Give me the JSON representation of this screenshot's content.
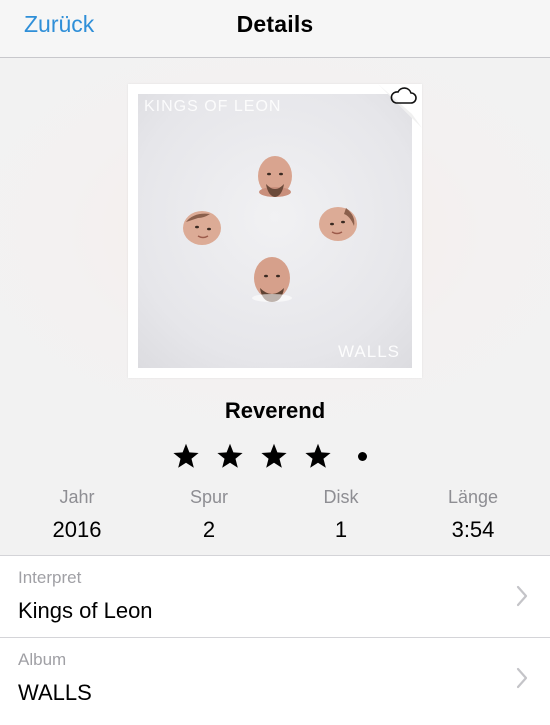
{
  "navbar": {
    "back_label": "Zurück",
    "title": "Details"
  },
  "artwork": {
    "band_text": "KINGS OF LEON",
    "album_text": "WALLS",
    "icon": "cloud-icon"
  },
  "track": {
    "title": "Reverend"
  },
  "rating": {
    "stars": 4,
    "max": 5
  },
  "meta": [
    {
      "label": "Jahr",
      "value": "2016"
    },
    {
      "label": "Spur",
      "value": "2"
    },
    {
      "label": "Disk",
      "value": "1"
    },
    {
      "label": "Länge",
      "value": "3:54"
    }
  ],
  "rows": [
    {
      "label": "Interpret",
      "value": "Kings of Leon"
    },
    {
      "label": "Album",
      "value": "WALLS"
    }
  ],
  "colors": {
    "accent": "#2f8fd8",
    "secondary_text": "#8e8e93"
  }
}
